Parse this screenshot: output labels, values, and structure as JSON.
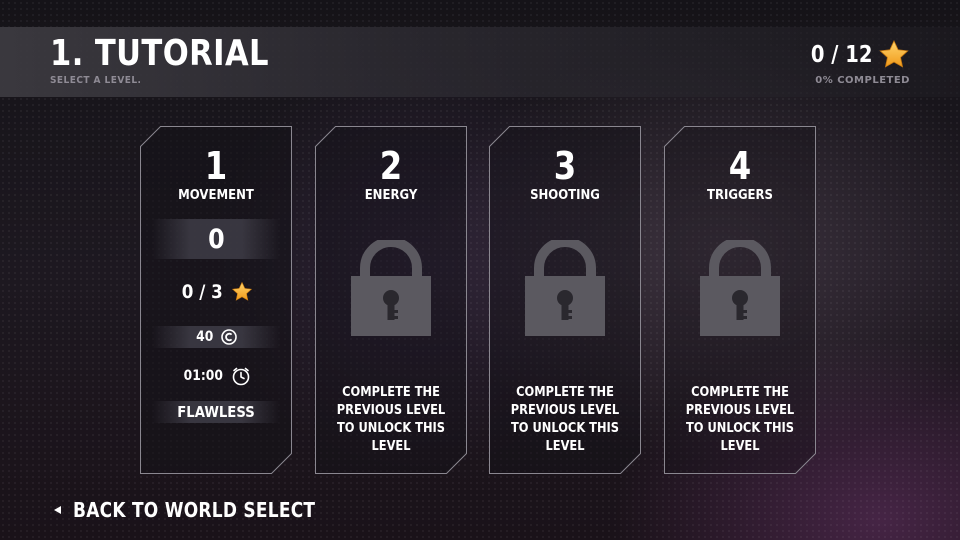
{
  "header": {
    "title": "1. TUTORIAL",
    "subtitle": "SELECT A LEVEL.",
    "stars_total": "0 / 12",
    "completed": "0% COMPLETED"
  },
  "levels": [
    {
      "number": "1",
      "name": "MOVEMENT",
      "locked": false,
      "score": "0",
      "stars": "0 / 3",
      "coins": "40",
      "time": "01:00",
      "flawless": "FLAWLESS"
    },
    {
      "number": "2",
      "name": "ENERGY",
      "locked": true,
      "unlock_text": "COMPLETE THE PREVIOUS LEVEL TO UNLOCK THIS LEVEL"
    },
    {
      "number": "3",
      "name": "SHOOTING",
      "locked": true,
      "unlock_text": "COMPLETE THE PREVIOUS LEVEL TO UNLOCK THIS LEVEL"
    },
    {
      "number": "4",
      "name": "TRIGGERS",
      "locked": true,
      "unlock_text": "COMPLETE THE PREVIOUS LEVEL TO UNLOCK THIS LEVEL"
    }
  ],
  "footer": {
    "back_label": "BACK TO WORLD SELECT"
  },
  "icons": {
    "star": "star-icon",
    "coin": "coin-icon",
    "timer": "timer-icon",
    "lock": "lock-icon",
    "back": "back-arrow-icon"
  },
  "colors": {
    "star": "#f5a623",
    "lock": "#5b5960",
    "frame": "#8a8790"
  }
}
